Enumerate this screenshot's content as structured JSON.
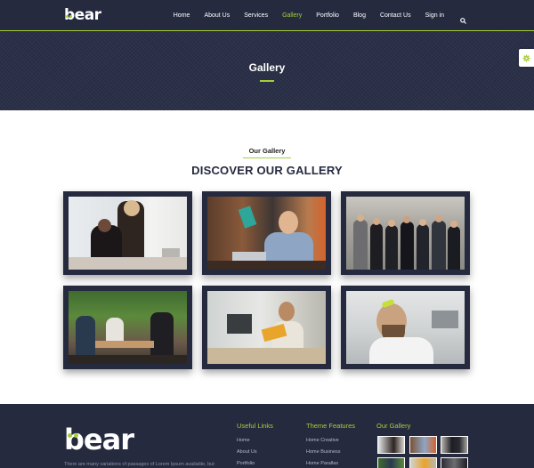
{
  "brand": {
    "logo_text": "bear"
  },
  "nav": {
    "items": [
      "Home",
      "About Us",
      "Services",
      "Gallery",
      "Portfolio",
      "Blog",
      "Contact Us",
      "Sign in"
    ],
    "active": "Gallery",
    "search_icon": "search-icon"
  },
  "hero": {
    "title": "Gallery"
  },
  "settings": {
    "icon": "gear-icon"
  },
  "gallery": {
    "subtitle": "Our Gallery",
    "title": "DISCOVER OUR GALLERY",
    "images": [
      {
        "name": "two-women-at-laptop"
      },
      {
        "name": "man-at-desk-with-laptop"
      },
      {
        "name": "business-team-standing"
      },
      {
        "name": "group-meeting-at-cafe-table"
      },
      {
        "name": "man-reading-in-office"
      },
      {
        "name": "smiling-bearded-man"
      }
    ]
  },
  "footer": {
    "logo_text": "bear",
    "description": "There are many variations of passages of Lorem Ipsum available, but",
    "useful_links": {
      "title": "Useful Links",
      "items": [
        "Home",
        "About Us",
        "Portfolio"
      ]
    },
    "theme_features": {
      "title": "Theme Features",
      "items": [
        "Home Creative",
        "Home Business",
        "Home Parallax"
      ]
    },
    "our_gallery": {
      "title": "Our Gallery"
    }
  },
  "colors": {
    "accent": "#a6ce39",
    "dark": "#252a3f",
    "hero": "#2a3048"
  }
}
